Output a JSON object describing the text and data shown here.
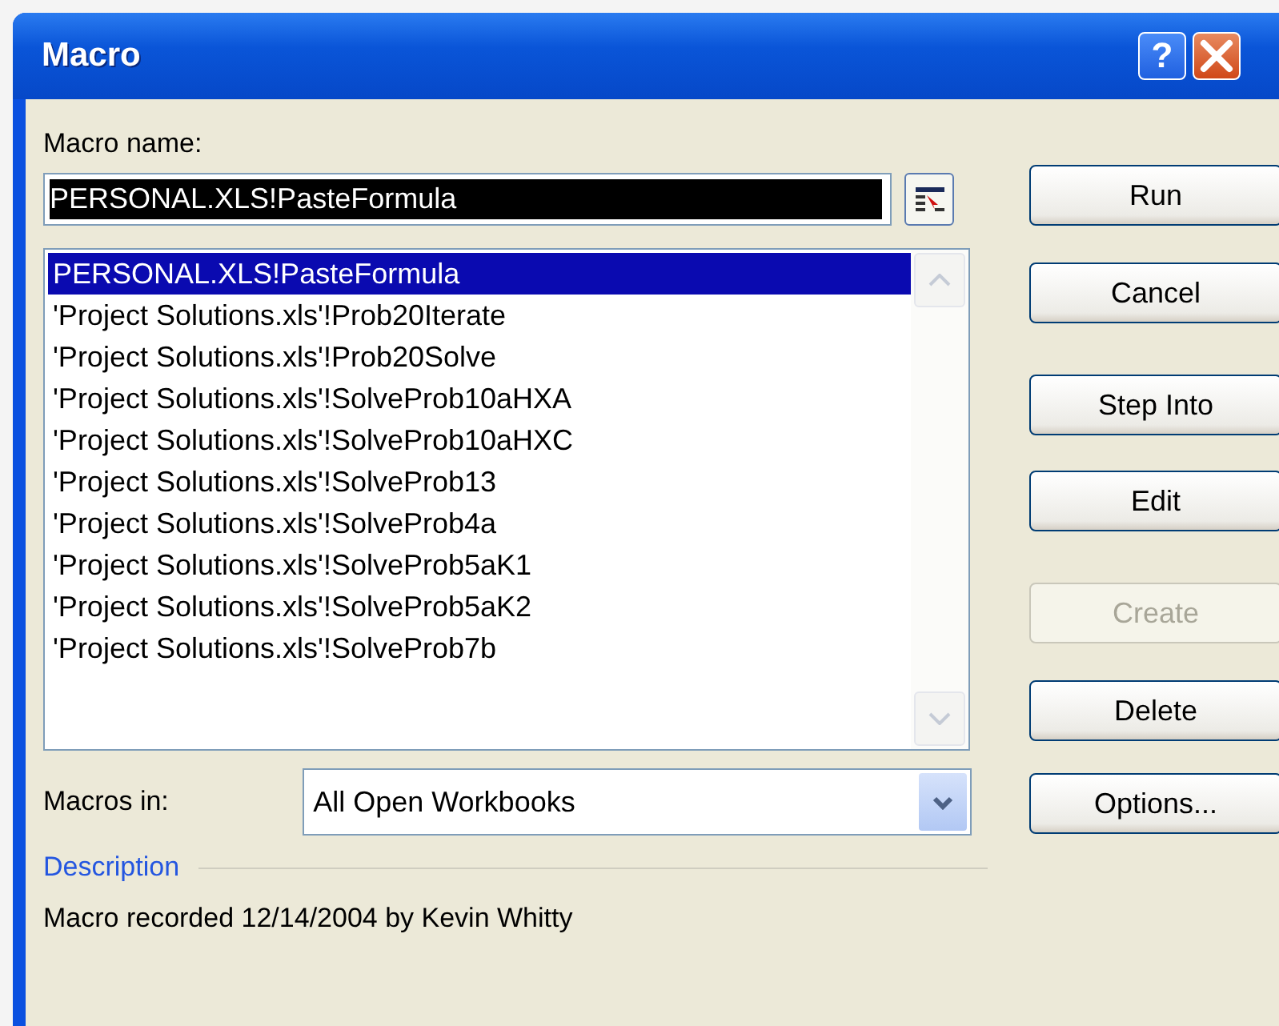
{
  "window": {
    "title": "Macro",
    "help_button": "?"
  },
  "macro_name": {
    "label": "Macro name:",
    "value": "PERSONAL.XLS!PasteFormula"
  },
  "macros": [
    {
      "name": "PERSONAL.XLS!PasteFormula",
      "selected": true
    },
    {
      "name": "'Project Solutions.xls'!Prob20Iterate",
      "selected": false
    },
    {
      "name": "'Project Solutions.xls'!Prob20Solve",
      "selected": false
    },
    {
      "name": "'Project Solutions.xls'!SolveProb10aHXA",
      "selected": false
    },
    {
      "name": "'Project Solutions.xls'!SolveProb10aHXC",
      "selected": false
    },
    {
      "name": "'Project Solutions.xls'!SolveProb13",
      "selected": false
    },
    {
      "name": "'Project Solutions.xls'!SolveProb4a",
      "selected": false
    },
    {
      "name": "'Project Solutions.xls'!SolveProb5aK1",
      "selected": false
    },
    {
      "name": "'Project Solutions.xls'!SolveProb5aK2",
      "selected": false
    },
    {
      "name": "'Project Solutions.xls'!SolveProb7b",
      "selected": false
    }
  ],
  "buttons": [
    {
      "label": "Run",
      "disabled": false
    },
    {
      "label": "Cancel",
      "disabled": false
    },
    {
      "label": "Step Into",
      "disabled": false
    },
    {
      "label": "Edit",
      "disabled": false
    },
    {
      "label": "Create",
      "disabled": true
    },
    {
      "label": "Delete",
      "disabled": false
    },
    {
      "label": "Options...",
      "disabled": false
    }
  ],
  "macros_in": {
    "label": "Macros in:",
    "value": "All Open Workbooks"
  },
  "description": {
    "heading": "Description",
    "text": "Macro recorded 12/14/2004 by Kevin Whitty"
  }
}
